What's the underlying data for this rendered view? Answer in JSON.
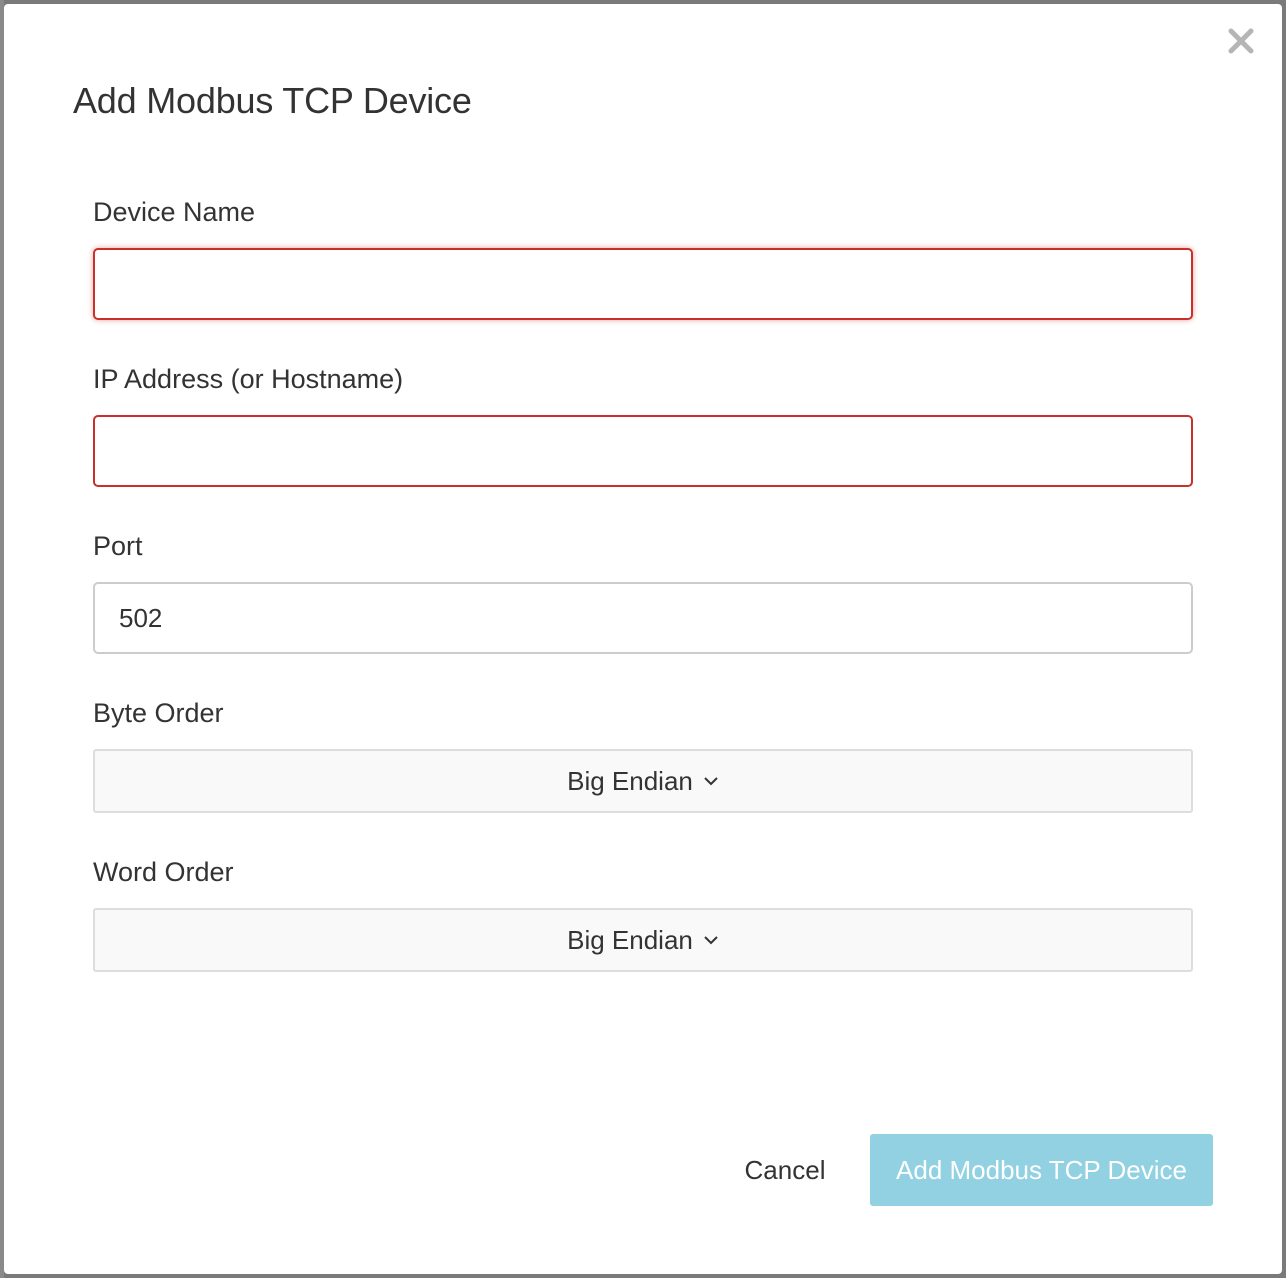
{
  "dialog": {
    "title": "Add Modbus TCP Device"
  },
  "form": {
    "device_name": {
      "label": "Device Name",
      "value": "",
      "state": "invalid"
    },
    "ip_address": {
      "label": "IP Address (or Hostname)",
      "value": "",
      "state": "invalid"
    },
    "port": {
      "label": "Port",
      "value": "502"
    },
    "byte_order": {
      "label": "Byte Order",
      "selected": "Big Endian"
    },
    "word_order": {
      "label": "Word Order",
      "selected": "Big Endian"
    }
  },
  "actions": {
    "cancel_label": "Cancel",
    "submit_label": "Add Modbus TCP Device",
    "submit_enabled": false
  },
  "icons": {
    "close": "close-icon",
    "dropdown": "chevron-down-icon"
  },
  "colors": {
    "error_border": "#c9302c",
    "primary_disabled": "#91d1e2",
    "backdrop": "#7a7a7a"
  }
}
